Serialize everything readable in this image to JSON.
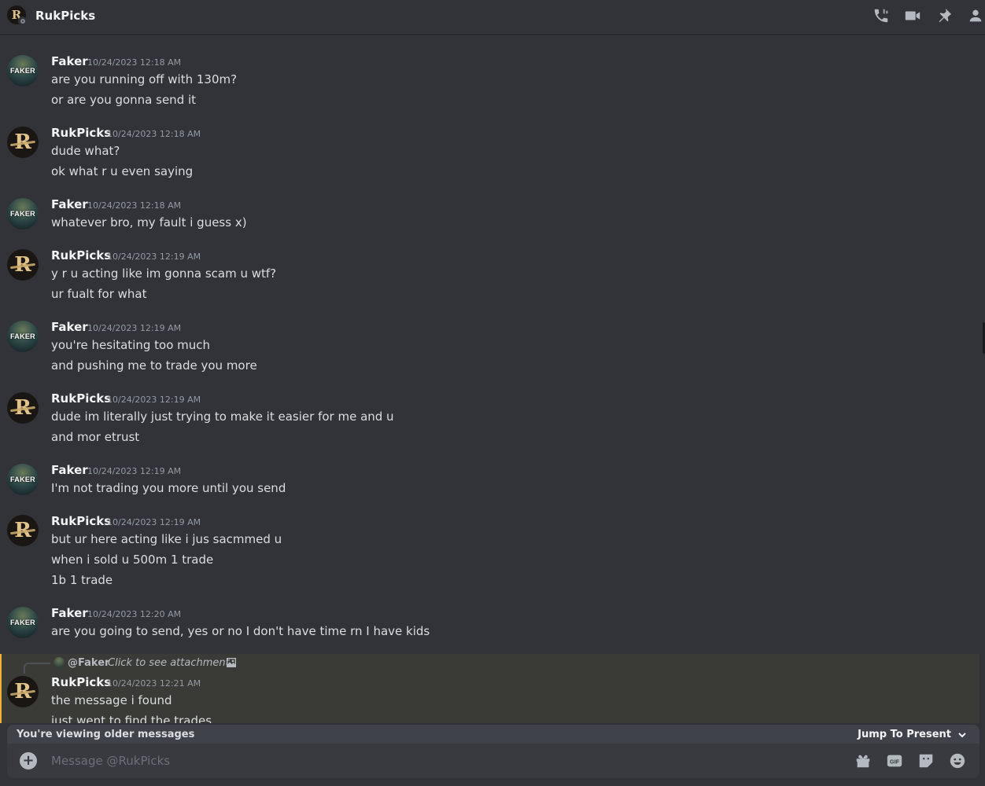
{
  "header": {
    "title": "RukPicks",
    "avatar_letter": "R",
    "icons": [
      "phone-call-icon",
      "video-call-icon",
      "pin-icon",
      "member-list-icon"
    ]
  },
  "messages": [
    {
      "author": "Faker",
      "timestamp": "10/24/2023 12:18 AM",
      "avatar_text": "FAKER",
      "lines": [
        "are you running off with 130m?",
        "or are you gonna send it"
      ]
    },
    {
      "author": "RukPicks",
      "timestamp": "10/24/2023 12:18 AM",
      "avatar_text": "R",
      "lines": [
        "dude what?",
        "ok what r u even saying"
      ]
    },
    {
      "author": "Faker",
      "timestamp": "10/24/2023 12:18 AM",
      "avatar_text": "FAKER",
      "lines": [
        "whatever bro, my fault i guess x)"
      ]
    },
    {
      "author": "RukPicks",
      "timestamp": "10/24/2023 12:19 AM",
      "avatar_text": "R",
      "lines": [
        "y r u acting like im gonna scam u wtf?",
        "ur fualt for what"
      ]
    },
    {
      "author": "Faker",
      "timestamp": "10/24/2023 12:19 AM",
      "avatar_text": "FAKER",
      "lines": [
        "you're hesitating too much",
        "and pushing me to trade you more"
      ]
    },
    {
      "author": "RukPicks",
      "timestamp": "10/24/2023 12:19 AM",
      "avatar_text": "R",
      "lines": [
        "dude im literally just trying to make it easier for me and u",
        "and mor etrust"
      ]
    },
    {
      "author": "Faker",
      "timestamp": "10/24/2023 12:19 AM",
      "avatar_text": "FAKER",
      "lines": [
        "I'm not trading you more until you send"
      ]
    },
    {
      "author": "RukPicks",
      "timestamp": "10/24/2023 12:19 AM",
      "avatar_text": "R",
      "lines": [
        "but ur here acting like i jus sacmmed u",
        "when i sold u 500m 1 trade",
        "1b 1 trade"
      ]
    },
    {
      "author": "Faker",
      "timestamp": "10/24/2023 12:20 AM",
      "avatar_text": "FAKER",
      "lines": [
        "are you going to send, yes or no I don't have time rn I have kids"
      ]
    },
    {
      "author": "RukPicks",
      "timestamp": "10/24/2023 12:21 AM",
      "avatar_text": "R",
      "reply": {
        "mention": "@Faker",
        "text": "Click to see attachment"
      },
      "lines": [
        "the message i found",
        "just went to find the trades"
      ]
    }
  ],
  "older_bar": {
    "text": "You're viewing older messages",
    "jump_label": "Jump To Present"
  },
  "composer": {
    "placeholder": "Message @RukPicks",
    "icons": [
      "add-attachment-icon",
      "gift-icon",
      "gif-icon",
      "sticker-icon",
      "emoji-icon"
    ],
    "gif_label": "GIF"
  },
  "colors": {
    "background": "#313338",
    "highlight_bar": "#f0b232",
    "muted_text": "#949ba4"
  }
}
